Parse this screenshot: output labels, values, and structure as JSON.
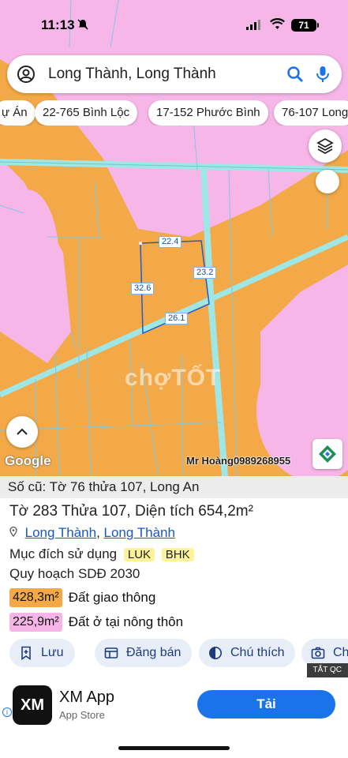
{
  "status": {
    "time": "11:13",
    "battery": "71"
  },
  "search": {
    "query": "Long Thành, Long Thành"
  },
  "chips": [
    "ự Án",
    "22-765 Bình Lộc",
    "17-152 Phước Bình",
    "76-107 Long"
  ],
  "map": {
    "dimensions": [
      "22.4",
      "23.2",
      "32.6",
      "26.1"
    ],
    "watermark": "chợTỐT",
    "google": "Google",
    "author": "Mr Hoàng0989268955"
  },
  "parcel": {
    "old_number": "Số cũ: Tờ 76 thửa 107, Long An",
    "title": "Tờ 283 Thửa 107, Diện tích 654,2m²",
    "district": "Long Thành",
    "province": "Long Thành",
    "location_separator": ", ",
    "purpose_label": "Mục đích sử dụng",
    "purpose_tags": [
      "LUK",
      "BHK"
    ],
    "plan_label": "Quy hoạch SDĐ 2030",
    "areas": [
      {
        "amount": "428,3m²",
        "label": "Đất giao thông",
        "color": "#f3a947"
      },
      {
        "amount": "225,9m²",
        "label": "Đất ở tại nông thôn",
        "color": "#f6b5e7"
      }
    ]
  },
  "actions": [
    "Lưu",
    "Đăng bán",
    "Chú thích",
    "Ch"
  ],
  "ad": {
    "close_label": "TẮT QC",
    "app_name": "XM App",
    "store": "App Store",
    "logo_text": "XM",
    "cta": "Tải",
    "info_icon": "i"
  },
  "colors": {
    "road_zone": "#f3a947",
    "residential": "#f6b5e7",
    "road": "#9ee7e6",
    "accent": "#1a73e8"
  }
}
